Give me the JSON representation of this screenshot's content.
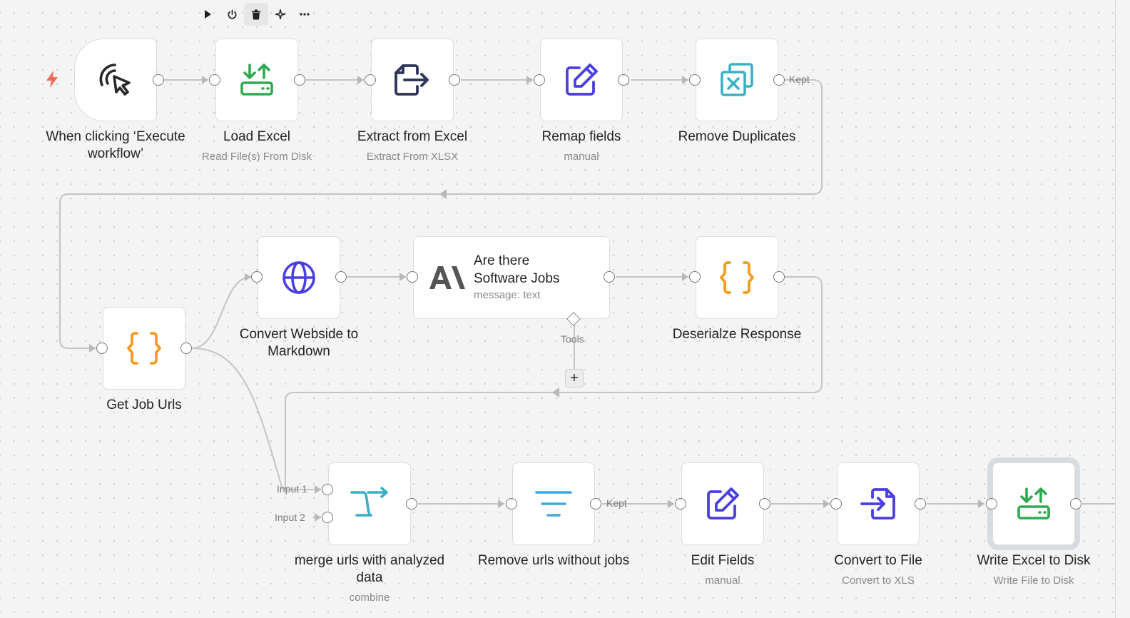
{
  "toolbar": {
    "items": [
      "play-icon",
      "power-icon",
      "trash-icon",
      "sparkle-icon",
      "more-icon"
    ]
  },
  "nodes": {
    "trigger": {
      "label": "When clicking ‘Execute workflow’",
      "sub": ""
    },
    "load_excel": {
      "label": "Load Excel",
      "sub": "Read File(s) From Disk"
    },
    "extract_excel": {
      "label": "Extract from Excel",
      "sub": "Extract From XLSX"
    },
    "remap_fields": {
      "label": "Remap fields",
      "sub": "manual"
    },
    "remove_duplicates": {
      "label": "Remove Duplicates",
      "sub": ""
    },
    "get_job_urls": {
      "label": "Get Job Urls",
      "sub": ""
    },
    "convert_website": {
      "label": "Convert Webside to Markdown",
      "sub": ""
    },
    "software_jobs": {
      "title": "Are there Software Jobs",
      "sub": "message: text"
    },
    "deserialize": {
      "label": "Deserialze Response",
      "sub": ""
    },
    "merge": {
      "label": "merge urls with analyzed data",
      "sub": "combine"
    },
    "remove_urls": {
      "label": "Remove urls without jobs",
      "sub": ""
    },
    "edit_fields": {
      "label": "Edit Fields",
      "sub": "manual"
    },
    "convert_file": {
      "label": "Convert to File",
      "sub": "Convert to XLS"
    },
    "write_excel": {
      "label": "Write Excel to Disk",
      "sub": "Write File to Disk"
    }
  },
  "edge_labels": {
    "kept_1": "Kept",
    "kept_2": "Kept",
    "tools": "Tools",
    "input_1": "Input 1",
    "input_2": "Input 2"
  },
  "colors": {
    "canvas": "#f4f4f4",
    "wire": "#c4c4c4",
    "green": "#2faa4f",
    "navy": "#2d3558",
    "indigo": "#4a3fe0",
    "teal": "#3ab0c4",
    "orange": "#f39c1f",
    "sky": "#3fa9dd",
    "trigger_bolt": "#f06a5a"
  }
}
